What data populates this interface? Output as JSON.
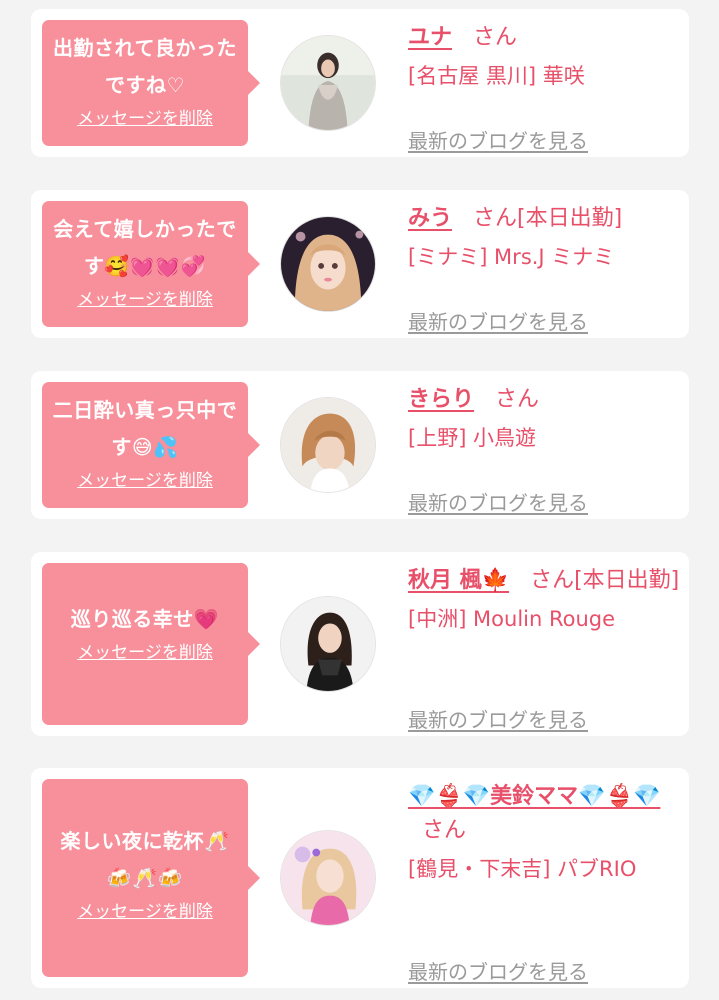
{
  "entries": [
    {
      "message": "出勤されて良かったですね♡",
      "delete_label": "メッセージを削除",
      "name": "ユナ",
      "honorific": "さん",
      "status": "",
      "shop": "[名古屋 黒川] 華咲",
      "blog_label": "最新のブログを見る"
    },
    {
      "message": "会えて嬉しかったです🥰💓💓💞",
      "delete_label": "メッセージを削除",
      "name": "みう",
      "honorific": "さん",
      "status": "[本日出勤]",
      "shop": "[ミナミ] Mrs.J ミナミ",
      "blog_label": "最新のブログを見る"
    },
    {
      "message": "二日酔い真っ只中です😅💦",
      "delete_label": "メッセージを削除",
      "name": "きらり",
      "honorific": "さん",
      "status": "",
      "shop": "[上野] 小鳥遊",
      "blog_label": "最新のブログを見る"
    },
    {
      "message": "巡り巡る幸せ💗",
      "delete_label": "メッセージを削除",
      "name": "秋月 楓🍁",
      "honorific": "さん",
      "status": "[本日出勤]",
      "shop": "[中洲] Moulin Rouge",
      "blog_label": "最新のブログを見る"
    },
    {
      "message": "楽しい夜に乾杯🥂🍻🥂🍻",
      "delete_label": "メッセージを削除",
      "name": "💎👙💎美鈴ママ💎👙💎",
      "honorific": "さん",
      "status": "",
      "shop": "[鶴見・下末吉] パブRIO",
      "blog_label": "最新のブログを見る"
    }
  ],
  "colors": {
    "bubble": "#f7909b",
    "accent": "#e8506a",
    "link_gray": "#9a9a9a",
    "background": "#f4f3f3"
  }
}
